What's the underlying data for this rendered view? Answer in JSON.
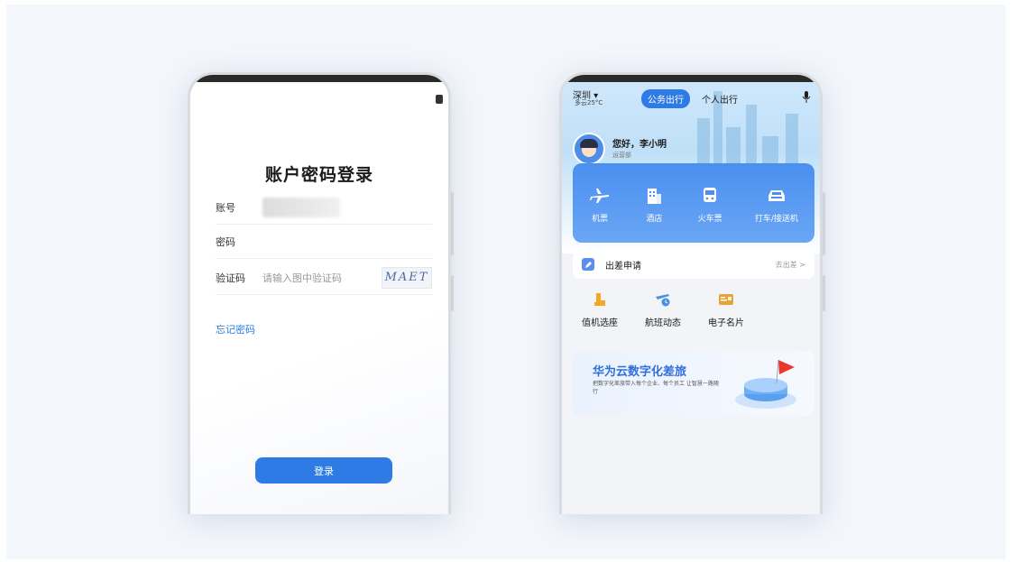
{
  "login": {
    "title": "账户密码登录",
    "account_label": "账号",
    "password_label": "密码",
    "captcha_label": "验证码",
    "captcha_placeholder": "请输入图中验证码",
    "captcha_text": "MAET",
    "forgot_label": "忘记密码",
    "submit_label": "登录"
  },
  "travel": {
    "city": "深圳",
    "weather": "多云25°C",
    "tabs": [
      {
        "label": "公务出行",
        "active": true
      },
      {
        "label": "个人出行",
        "active": false
      }
    ],
    "greeting": "您好，李小明",
    "department": "运营部",
    "transport": [
      {
        "label": "机票",
        "icon": "plane-icon"
      },
      {
        "label": "酒店",
        "icon": "hotel-icon"
      },
      {
        "label": "火车票",
        "icon": "train-icon"
      },
      {
        "label": "打车/接送机",
        "icon": "car-icon"
      }
    ],
    "apply": {
      "label": "出差申请",
      "link": "去出差 >"
    },
    "quick": [
      {
        "label": "值机选座",
        "icon": "seat-icon",
        "color": "#f5a623"
      },
      {
        "label": "航班动态",
        "icon": "flight-status-icon",
        "color": "#4a90e2"
      },
      {
        "label": "电子名片",
        "icon": "card-icon",
        "color": "#e8a23b"
      }
    ],
    "banner": {
      "title": "华为云数字化差旅",
      "subtitle": "把数字化差旅带入每个企业、每个员工 让智慧一路随行"
    }
  },
  "colors": {
    "accent": "#2f7be6",
    "transport_bg": "#4a8ff0"
  }
}
